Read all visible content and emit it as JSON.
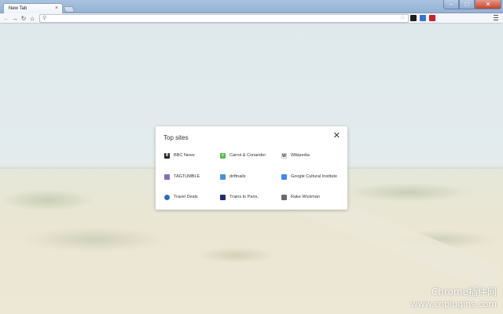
{
  "tab": {
    "title": "New Tab",
    "close_glyph": "×"
  },
  "toolbar": {
    "back": "←",
    "forward": "→",
    "reload": "↻",
    "home": "⌂",
    "omnibox_value": "",
    "search_glyph": "⚲",
    "star_glyph": "☆",
    "extensions": [
      {
        "name": "extension-black-icon",
        "color": "#1e1e1e"
      },
      {
        "name": "extension-translate-icon",
        "color": "#3b73c8"
      },
      {
        "name": "extension-red-icon",
        "color": "#c8242c"
      }
    ]
  },
  "window": {
    "min": "–",
    "max": "□",
    "close": "✕"
  },
  "top_sites": {
    "title": "Top sites",
    "close_glyph": "✕",
    "sites": [
      {
        "label": "BBC News",
        "icon": "bbc-icon",
        "color": "#222222",
        "glyph": "B"
      },
      {
        "label": "Carrot & Coriander",
        "icon": "carrot-icon",
        "color": "#54b948",
        "glyph": "c"
      },
      {
        "label": "Wikipedia",
        "icon": "wikipedia-icon",
        "color": "#ffffff",
        "glyph": "W"
      },
      {
        "label": "TAGTUMBLE",
        "icon": "tagtumble-icon",
        "color": "#8a6bb5",
        "glyph": ""
      },
      {
        "label": "driftnails",
        "icon": "driftnails-icon",
        "color": "#4a90d9",
        "glyph": ""
      },
      {
        "label": "Google Cultural Institute",
        "icon": "google-cultural-icon",
        "color": "#4285f4",
        "glyph": ""
      },
      {
        "label": "Travel Deals",
        "icon": "travel-deals-icon",
        "color": "#2a6fb5",
        "glyph": ""
      },
      {
        "label": "Trains to Paris,",
        "icon": "trains-icon",
        "color": "#1c2f6e",
        "glyph": ""
      },
      {
        "label": "Rake Wickman",
        "icon": "rake-wickman-icon",
        "color": "#6b6b6b",
        "glyph": ""
      }
    ]
  },
  "watermark": {
    "line1": "Chrome插件网",
    "line2": "www.cnplugins.com"
  }
}
